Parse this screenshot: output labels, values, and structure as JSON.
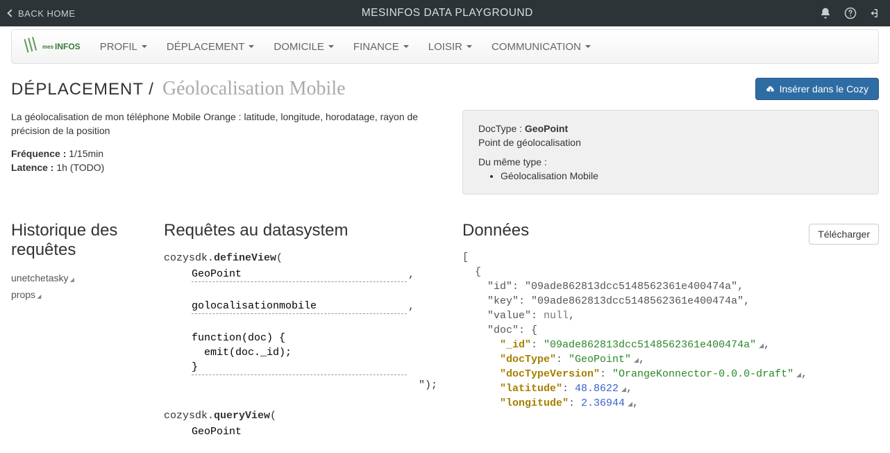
{
  "topbar": {
    "back": "BACK HOME",
    "title": "MESINFOS DATA PLAYGROUND"
  },
  "nav": {
    "logo": "INFOS",
    "items": [
      "PROFIL",
      "DÉPLACEMENT",
      "DOMICILE",
      "FINANCE",
      "LOISIR",
      "COMMUNICATION"
    ]
  },
  "breadcrumb": {
    "category": "DÉPLACEMENT /",
    "page": "Géolocalisation Mobile"
  },
  "insert_btn": "Insérer dans le Cozy",
  "description": "La géolocalisation de mon téléphone Mobile Orange : latitude, longitude, horodatage, rayon de précision de la position",
  "meta": {
    "freq_label": "Fréquence :",
    "freq_value": "1/15min",
    "lat_label": "Latence :",
    "lat_value": "1h (TODO)"
  },
  "well": {
    "doctype_label": "DocType :",
    "doctype_value": "GeoPoint",
    "doctype_desc": "Point de géolocalisation",
    "same_type_label": "Du même type :",
    "same_type_item": "Géolocalisation Mobile"
  },
  "sections": {
    "history": "Historique des requêtes",
    "requests": "Requêtes au datasystem",
    "data": "Données"
  },
  "history_items": [
    "unetchetasky",
    "props"
  ],
  "requests": {
    "define_prefix": "cozysdk.",
    "define_method": "defineView",
    "define_suffix": "(",
    "input1": "GeoPoint",
    "input2": "golocalisationmobile",
    "func_body": "function(doc) {\n  emit(doc._id);\n}",
    "close_paren": "\");",
    "query_prefix": "cozysdk.",
    "query_method": "queryView",
    "query_suffix": "(",
    "input3": "GeoPoint"
  },
  "download_btn": "Télécharger",
  "json": {
    "id_key": "\"id\"",
    "id_val": "\"09ade862813dcc5148562361e400474a\"",
    "key_key": "\"key\"",
    "key_val": "\"09ade862813dcc5148562361e400474a\"",
    "value_key": "\"value\"",
    "value_val": "null",
    "doc_key": "\"doc\"",
    "_id_key": "\"_id\"",
    "_id_val": "\"09ade862813dcc5148562361e400474a\"",
    "docType_key": "\"docType\"",
    "docType_val": "\"GeoPoint\"",
    "docTypeVersion_key": "\"docTypeVersion\"",
    "docTypeVersion_val": "\"OrangeKonnector-0.0.0-draft\"",
    "latitude_key": "\"latitude\"",
    "latitude_val": "48.8622",
    "longitude_key": "\"longitude\"",
    "longitude_val": "2.36944"
  }
}
